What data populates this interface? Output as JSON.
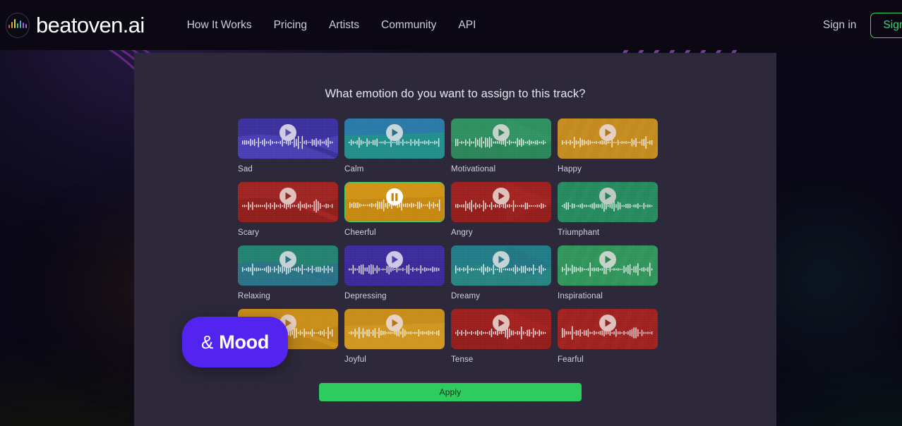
{
  "header": {
    "logo_text": "beatoven.ai",
    "logo_icon": "waveform-circle-icon",
    "nav": [
      {
        "label": "How It Works"
      },
      {
        "label": "Pricing"
      },
      {
        "label": "Artists"
      },
      {
        "label": "Community"
      },
      {
        "label": "API"
      }
    ],
    "signin_label": "Sign in",
    "signup_label": "Sign up",
    "signup_border_color": "#2fdc6b"
  },
  "panel": {
    "title": "What emotion do you want to assign to this track?",
    "apply_label": "Apply",
    "apply_color": "#2ecc5e",
    "selected_emotion": "Cheerful",
    "selected_border_color": "#3ddc72",
    "badge": {
      "ampersand": "&",
      "word": "Mood",
      "color": "#5323f0"
    },
    "emotions": [
      {
        "label": "Sad",
        "icon": "play-icon",
        "c1": "#3b2f9e",
        "c2": "#4b3fb5",
        "c3": "#2e2580",
        "selected": false,
        "badge_bg": "#cfcbe4",
        "badge_fg": "#5a51a8"
      },
      {
        "label": "Calm",
        "icon": "play-icon",
        "c1": "#2878a8",
        "c2": "#1f8f86",
        "c3": "#1d7f74",
        "selected": false,
        "badge_bg": "#c8d6dc",
        "badge_fg": "#2b6f86"
      },
      {
        "label": "Motivational",
        "icon": "play-icon",
        "c1": "#2e8f5e",
        "c2": "#23794f",
        "c3": "#2f9a66",
        "selected": false,
        "badge_bg": "#c6d3cb",
        "badge_fg": "#2c7d55"
      },
      {
        "label": "Happy",
        "icon": "play-icon",
        "c1": "#c2881c",
        "c2": "#b97d15",
        "c3": "#cc9424",
        "selected": false,
        "badge_bg": "#e6cfc3",
        "badge_fg": "#b3761a"
      },
      {
        "label": "Scary",
        "icon": "play-icon",
        "c1": "#9e2220",
        "c2": "#8c1c1a",
        "c3": "#b02a26",
        "selected": false,
        "badge_bg": "#dfc0bc",
        "badge_fg": "#8e2a26"
      },
      {
        "label": "Cheerful",
        "icon": "pause-icon",
        "c1": "#cf9213",
        "c2": "#c5860f",
        "c3": "#d89c1c",
        "selected": true,
        "badge_bg": "#ffffff",
        "badge_fg": "#c5860f"
      },
      {
        "label": "Angry",
        "icon": "play-icon",
        "c1": "#9c1f1d",
        "c2": "#8a1a18",
        "c3": "#ae2623",
        "selected": false,
        "badge_bg": "#dfc0bc",
        "badge_fg": "#8e2a26"
      },
      {
        "label": "Triumphant",
        "icon": "play-icon",
        "c1": "#24875c",
        "c2": "#1d7350",
        "c3": "#2b9468",
        "selected": false,
        "badge_bg": "#bdc9c1",
        "badge_fg": "#27805a"
      },
      {
        "label": "Relaxing",
        "icon": "play-icon",
        "c1": "#22806e",
        "c2": "#2a6e8a",
        "c3": "#246d86",
        "selected": false,
        "badge_bg": "#c3d2d3",
        "badge_fg": "#2a7184"
      },
      {
        "label": "Depressing",
        "icon": "play-icon",
        "c1": "#3b2a9c",
        "c2": "#33249044",
        "c3": "#4a38b5",
        "selected": false,
        "badge_bg": "#cdc7e8",
        "badge_fg": "#4b3aa8"
      },
      {
        "label": "Dreamy",
        "icon": "play-icon",
        "c1": "#1f7a86",
        "c2": "#2a8b7a",
        "c3": "#236f80",
        "selected": false,
        "badge_bg": "#c4d3d4",
        "badge_fg": "#26788a"
      },
      {
        "label": "Inspirational",
        "icon": "play-icon",
        "c1": "#2f9258",
        "c2": "#26804c",
        "c3": "#36a063",
        "selected": false,
        "badge_bg": "#c6d3ca",
        "badge_fg": "#2d8353"
      },
      {
        "label": "",
        "icon": "play-icon",
        "c1": "#c98d18",
        "c2": "#bb8113",
        "c3": "#d5971f",
        "selected": false,
        "badge_bg": "#e4cdbf",
        "badge_fg": "#b3761a"
      },
      {
        "label": "Joyful",
        "icon": "play-icon",
        "c1": "#c68c1a",
        "c2": "#d09620",
        "c3": "#bb8214",
        "selected": false,
        "badge_bg": "#e8d2c4",
        "badge_fg": "#b3761a"
      },
      {
        "label": "Tense",
        "icon": "play-icon",
        "c1": "#9a1e1c",
        "c2": "#8a1918",
        "c3": "#ac2422",
        "selected": false,
        "badge_bg": "#dfc0bc",
        "badge_fg": "#8e2a26"
      },
      {
        "label": "Fearful",
        "icon": "play-icon",
        "c1": "#9c1f1d",
        "c2": "#8b1a19",
        "c3": "#ae2522",
        "selected": false,
        "badge_bg": "#dfc0bc",
        "badge_fg": "#8e2a26"
      }
    ]
  }
}
